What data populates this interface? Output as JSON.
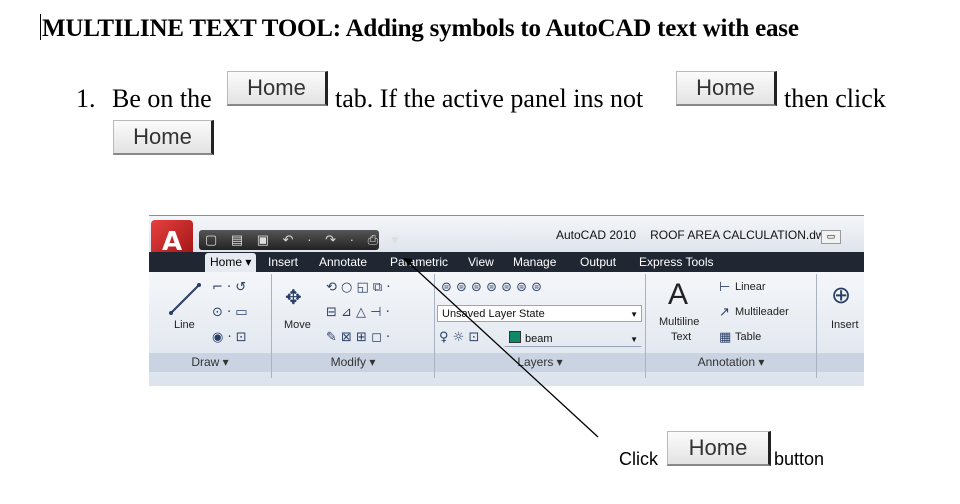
{
  "doc": {
    "heading": "MULTILINE TEXT TOOL:  Adding symbols to AutoCAD text with ease",
    "step_number": "1.",
    "step_part1": "Be on the",
    "step_part2": "tab. If the active panel ins not",
    "step_part3": "then click",
    "home_button_label": "Home",
    "click_label": "Click",
    "button_label": "button"
  },
  "autocad": {
    "logo": "A",
    "qat_icons": "▢ ▤ ▣ ↶ · ↷ · ⎙ ▾",
    "app_name": "AutoCAD 2010",
    "file_name": "ROOF AREA CALCULATION.dwg",
    "window_icon": "▭",
    "tabs": [
      "Home",
      "Insert",
      "Annotate",
      "Parametric",
      "View",
      "Manage",
      "Output",
      "Express Tools"
    ],
    "active_tab_arrow": "▾",
    "panels": {
      "draw": {
        "label": "Draw ▾",
        "line_label": "Line"
      },
      "modify": {
        "label": "Modify ▾",
        "move_label": "Move"
      },
      "layers": {
        "label": "Layers ▾",
        "layer_state": "Unsaved Layer State",
        "current_layer": "beam",
        "layer_color": "#0e8a6a"
      },
      "annotation": {
        "label": "Annotation ▾",
        "multiline_line1": "Multiline",
        "multiline_line2": "Text",
        "linear": "Linear",
        "multileader": "Multileader",
        "table": "Table"
      },
      "insert": {
        "label": "Insert"
      }
    }
  },
  "icons": {
    "draw_icons_1": "⌐ · ↺",
    "draw_icons_2": "⊙ · ▭",
    "draw_icons_3": "◉ · ⊡",
    "move_icon": "✥",
    "modify_row1": "⟲ ○ ◱ ⧉ ·",
    "modify_row2": "⊟ ⊿ △ ⊣ ·",
    "modify_row3": "✎ ⊠ ⊞ ◻ ·",
    "layers_row1": "⊜ ⊜ ⊜ ⊜ ⊜ ⊜ ⊜",
    "layers_icons": "♀ ☼ ⊡",
    "multiline_icon": "A",
    "linear_icon": "⊢",
    "multileader_icon": "↗",
    "table_icon": "▦",
    "insert_icon": "⊕"
  }
}
